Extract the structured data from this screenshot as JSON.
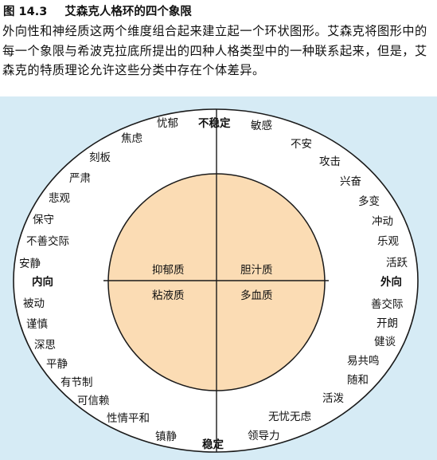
{
  "caption": {
    "figure_number": "图 14.3",
    "title": "艾森克人格环的四个象限",
    "body": "外向性和神经质这两个维度组合起来建立起一个环状图形。艾森克将图形中的每一个象限与希波克拉底所提出的四种人格类型中的一种联系起来，但是，艾森克的特质理论允许这些分类中存在个体差异。"
  },
  "axes": {
    "top": "不稳定",
    "bottom": "稳定",
    "left": "内向",
    "right": "外向"
  },
  "temperaments": {
    "upper_left": "抑郁质",
    "upper_right": "胆汁质",
    "lower_left": "粘液质",
    "lower_right": "多血质"
  },
  "traits": {
    "upper_left": [
      "忧郁",
      "焦虑",
      "刻板",
      "严肃",
      "悲观",
      "保守",
      "不善交际",
      "安静"
    ],
    "upper_right": [
      "敏感",
      "不安",
      "攻击",
      "兴奋",
      "多变",
      "冲动",
      "乐观",
      "活跃"
    ],
    "lower_left": [
      "被动",
      "谨慎",
      "深思",
      "平静",
      "有节制",
      "可信赖",
      "性情平和",
      "镇静"
    ],
    "lower_right": [
      "善交际",
      "开朗",
      "健谈",
      "易共鸣",
      "随和",
      "活泼",
      "无忧无虑",
      "领导力"
    ]
  },
  "colors": {
    "panel_background": "#d6ebf5",
    "outer_circle": "#ffffff",
    "inner_circle": "#fbdcb4",
    "lines": "#1a1a1a"
  }
}
